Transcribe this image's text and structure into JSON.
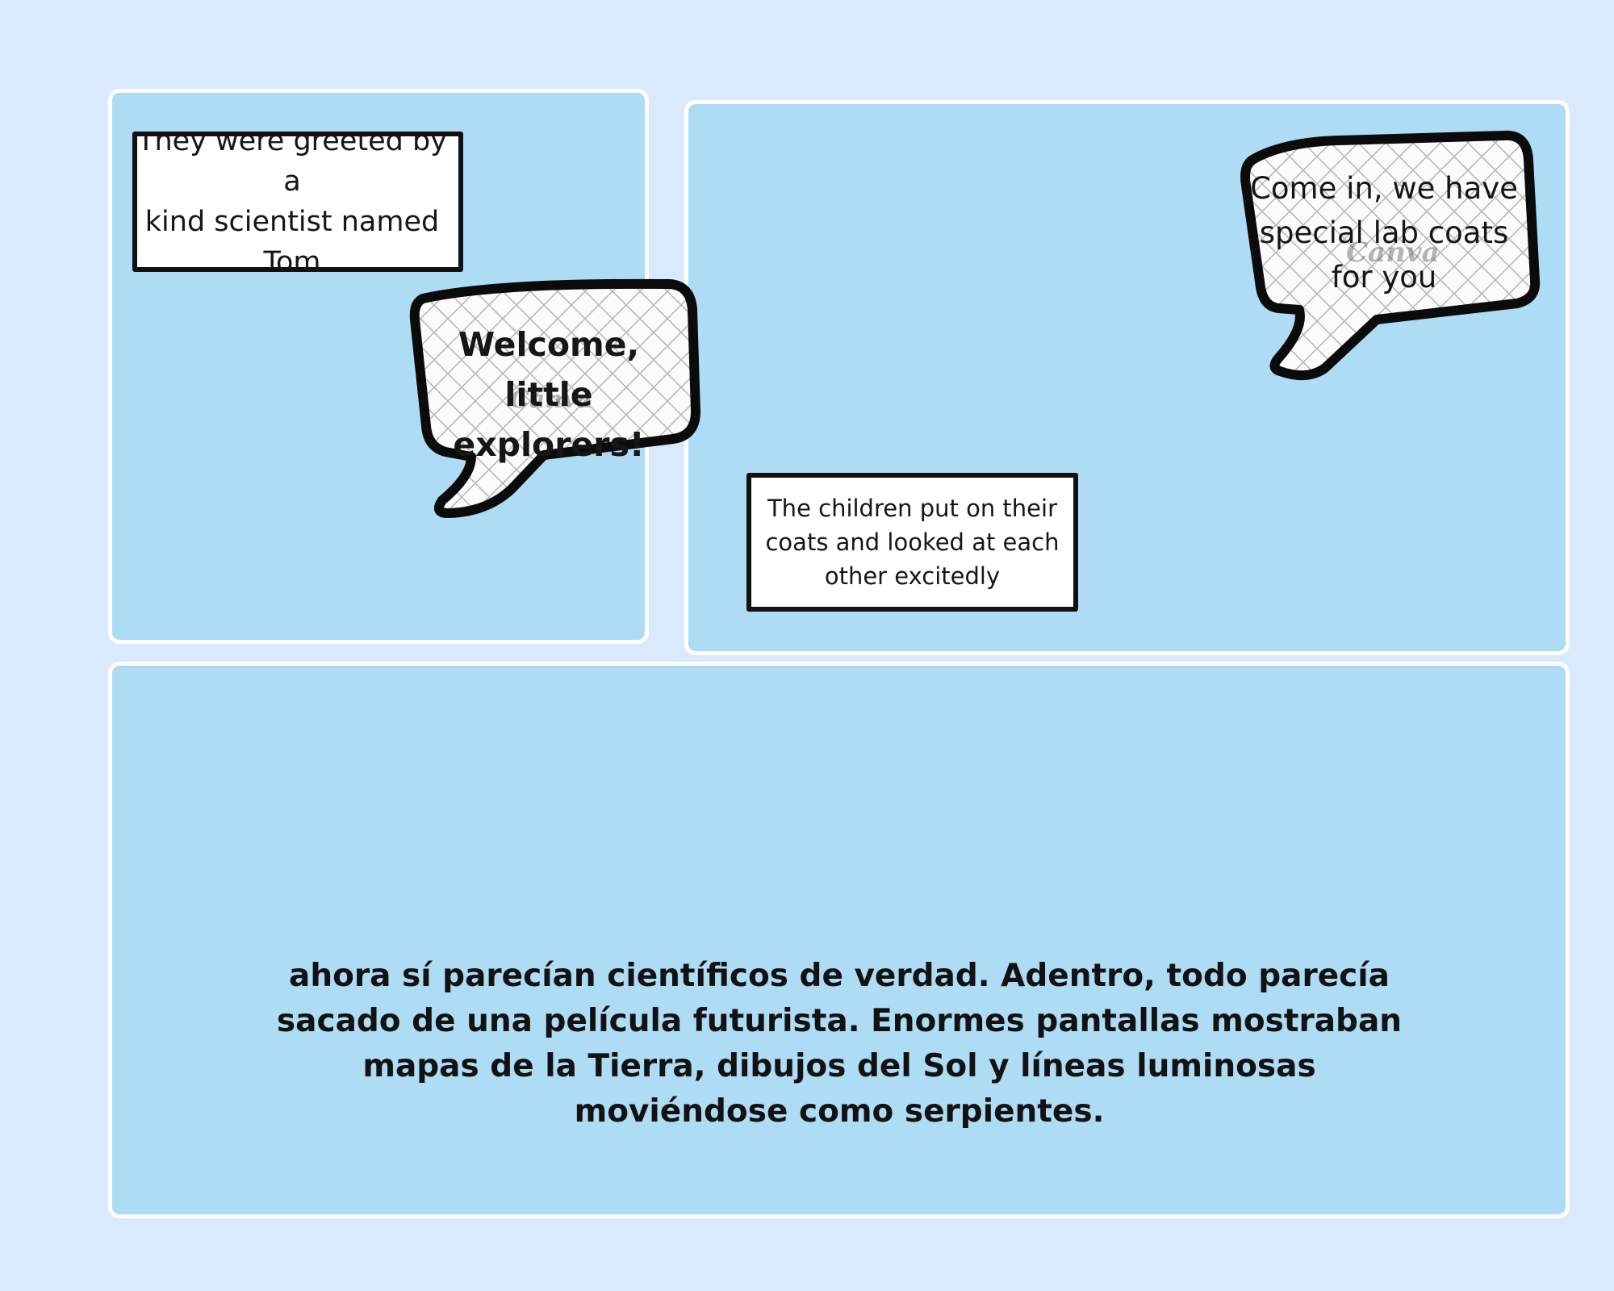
{
  "colors": {
    "page_background": "#d9e9fe",
    "panel_fill": "#aedcf5",
    "panel_border": "#ffffff",
    "ink": "#111111"
  },
  "panels": [
    {
      "caption": "They were greeted by a\nkind scientist named\nTom",
      "speech": "Welcome, little\nexplorers!",
      "watermark": "Canva"
    },
    {
      "caption": "The children put on their\ncoats and looked at each\nother excitedly",
      "speech": "Come in, we have\nspecial lab coats\nfor you",
      "watermark": "Canva"
    },
    {
      "narration": "ahora sí parecían científicos de verdad. Adentro, todo parecía sacado de una película futurista. Enormes pantallas mostraban mapas de la Tierra, dibujos del Sol y líneas luminosas moviéndose como serpientes."
    }
  ]
}
